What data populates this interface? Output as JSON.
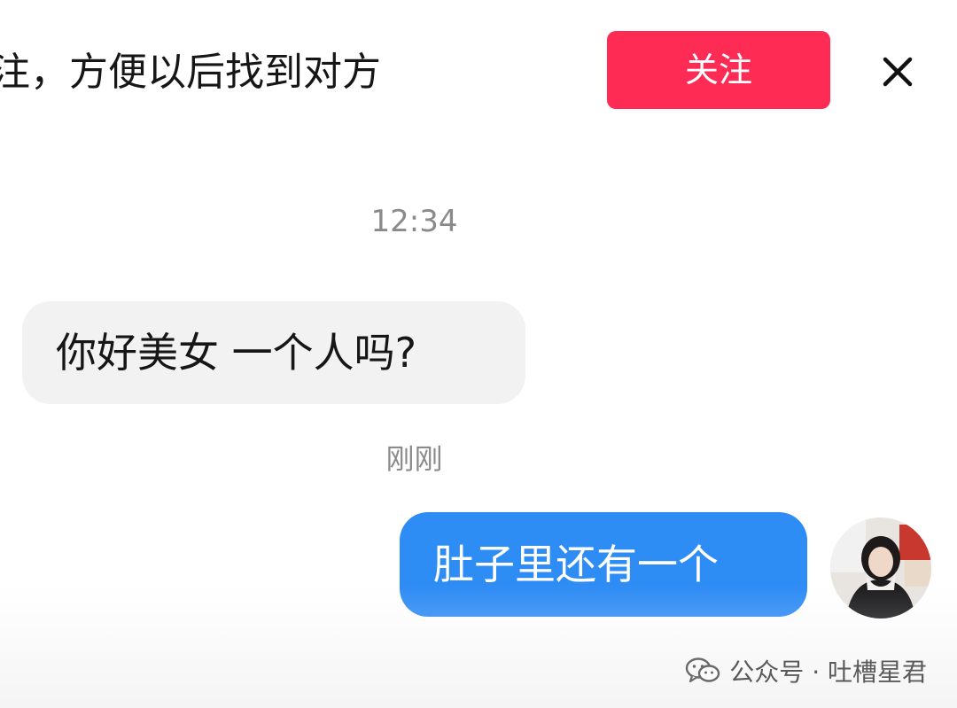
{
  "follow_bar": {
    "text": "注，方便以后找到对方",
    "follow_label": "关注",
    "close_icon": "close-icon",
    "accent": "#fe2c55"
  },
  "chat": {
    "timestamp_1": "12:34",
    "received_message": "你好美女 一个人吗?",
    "timestamp_2": "刚刚",
    "sent_message": "肚子里还有一个",
    "sent_bubble_color": "#2e8cf5",
    "received_bubble_color": "#f2f2f3"
  },
  "watermark": {
    "icon": "wechat-icon",
    "text": "公众号 · 吐槽星君"
  }
}
